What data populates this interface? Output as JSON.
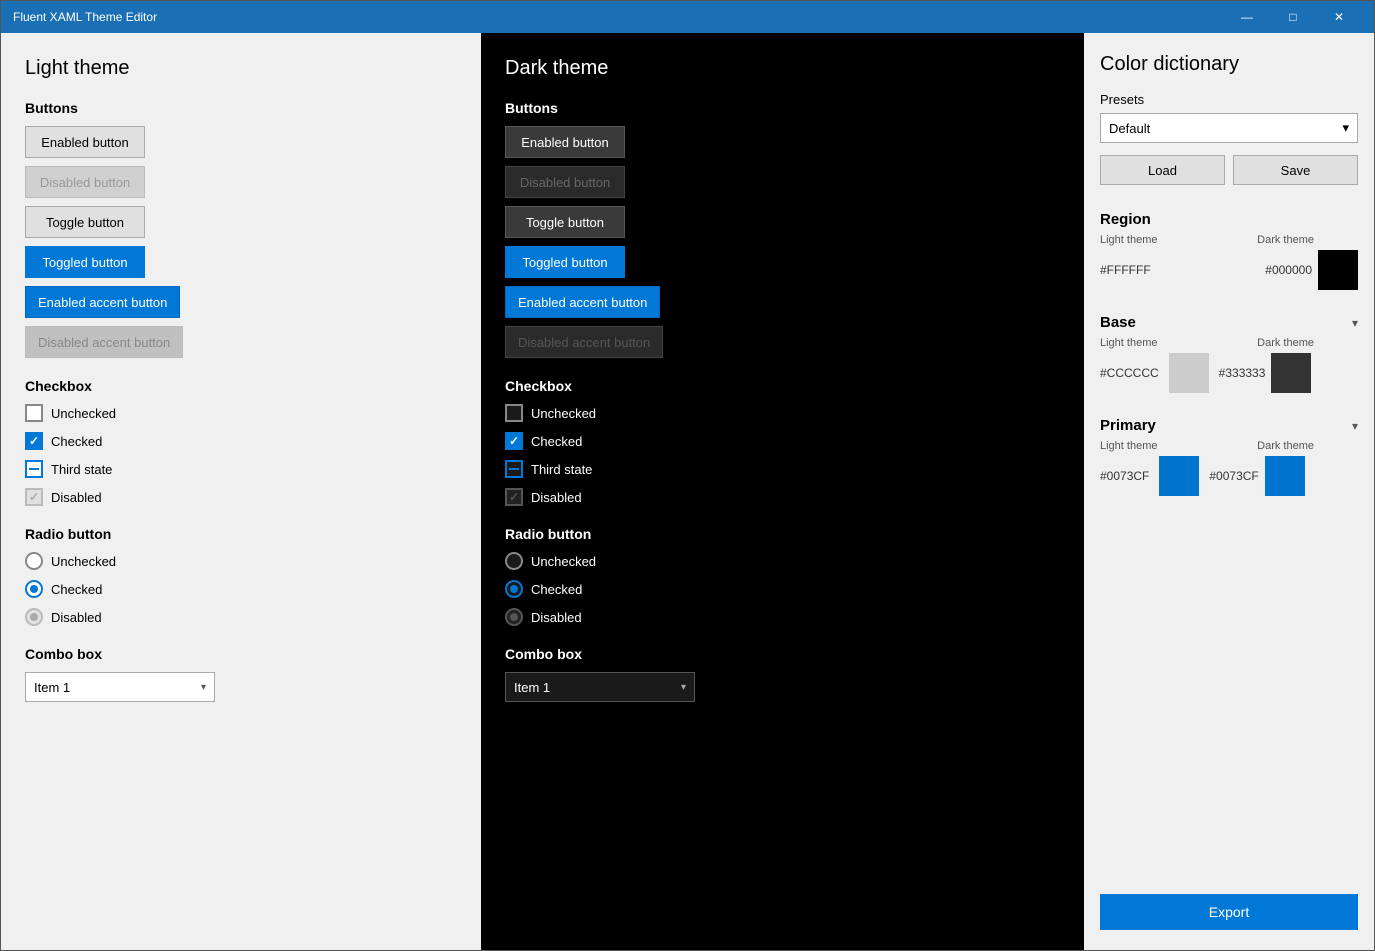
{
  "titlebar": {
    "title": "Fluent XAML Theme Editor",
    "minimize": "—",
    "maximize": "□",
    "close": "✕"
  },
  "light_panel": {
    "title": "Light theme",
    "buttons_label": "Buttons",
    "enabled_button": "Enabled button",
    "disabled_button": "Disabled button",
    "toggle_button": "Toggle button",
    "toggled_button": "Toggled button",
    "enabled_accent": "Enabled accent button",
    "disabled_accent": "Disabled accent button",
    "checkbox_label": "Checkbox",
    "unchecked": "Unchecked",
    "checked": "Checked",
    "third_state": "Third state",
    "disabled_check": "Disabled",
    "radio_label": "Radio button",
    "radio_unchecked": "Unchecked",
    "radio_checked": "Checked",
    "radio_disabled": "Disabled",
    "combo_label": "Combo box",
    "combo_item": "Item 1"
  },
  "dark_panel": {
    "title": "Dark theme",
    "buttons_label": "Buttons",
    "enabled_button": "Enabled button",
    "disabled_button": "Disabled button",
    "toggle_button": "Toggle button",
    "toggled_button": "Toggled button",
    "enabled_accent": "Enabled accent button",
    "disabled_accent": "Disabled accent button",
    "checkbox_label": "Checkbox",
    "unchecked": "Unchecked",
    "checked": "Checked",
    "third_state": "Third state",
    "disabled_check": "Disabled",
    "radio_label": "Radio button",
    "radio_unchecked": "Unchecked",
    "radio_checked": "Checked",
    "radio_disabled": "Disabled",
    "combo_label": "Combo box",
    "combo_item": "Item 1"
  },
  "color_panel": {
    "title": "Color dictionary",
    "presets_label": "Presets",
    "preset_value": "Default",
    "load_label": "Load",
    "save_label": "Save",
    "region_label": "Region",
    "light_theme_label": "Light theme",
    "dark_theme_label": "Dark theme",
    "region_light_hex": "#FFFFFF",
    "region_dark_hex": "#000000",
    "region_light_color": "#FFFFFF",
    "region_dark_color": "#000000",
    "base_label": "Base",
    "base_light_hex": "#CCCCCC",
    "base_dark_hex": "#333333",
    "base_light_color": "#CCCCCC",
    "base_dark_color": "#333333",
    "primary_label": "Primary",
    "primary_light_hex": "#0073CF",
    "primary_dark_hex": "#0073CF",
    "primary_light_color": "#0073CF",
    "primary_dark_color": "#0073CF",
    "export_label": "Export"
  }
}
